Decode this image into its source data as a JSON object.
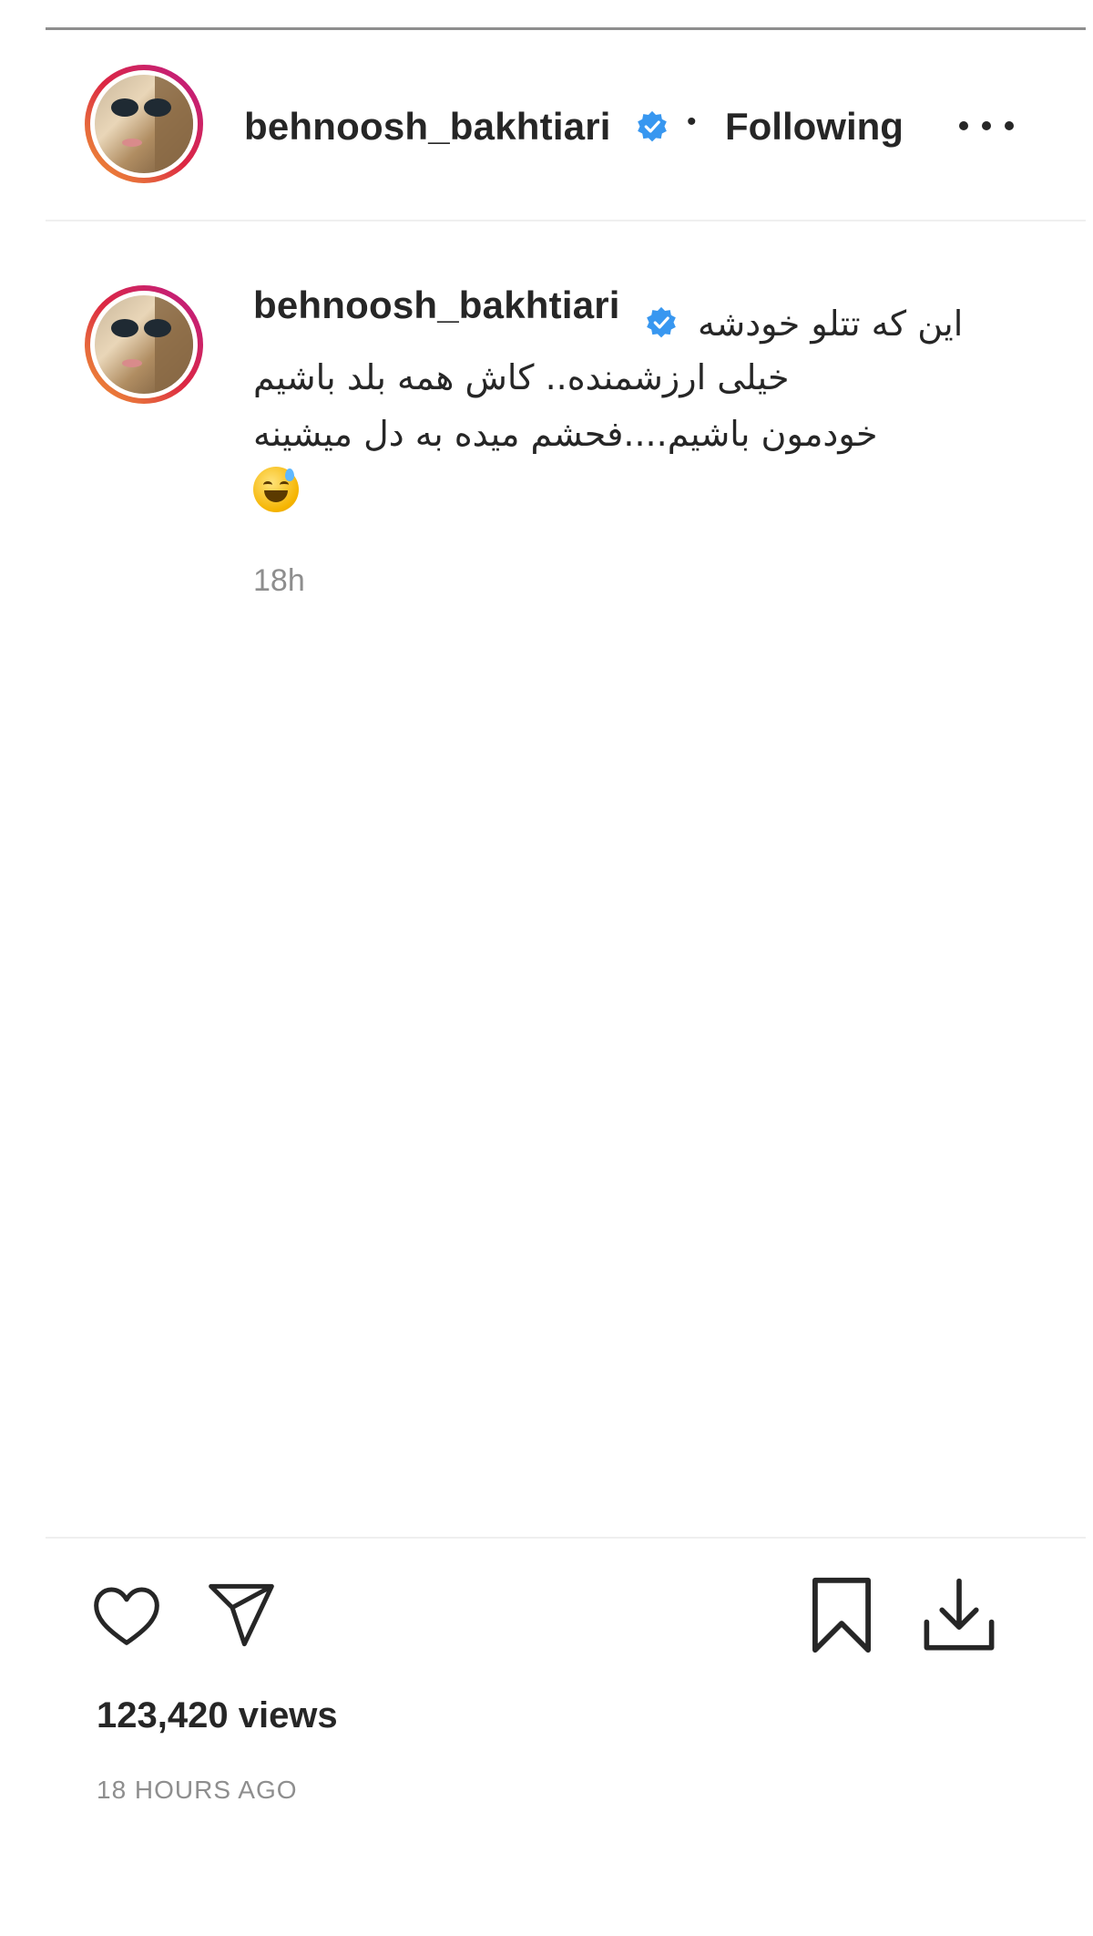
{
  "header": {
    "username": "behnoosh_bakhtiari",
    "separator": "•",
    "follow_status": "Following",
    "more_label": "..."
  },
  "caption": {
    "username": "behnoosh_bakhtiari",
    "lines": [
      "این که تتلو خودشه",
      "خیلی ارزشمنده.. کاش همه بلد باشیم",
      "خودمون باشیم....فحشم میده به دل میشینه"
    ],
    "emoji": "😅",
    "time": "18h"
  },
  "stats": {
    "views": "123,420 views",
    "posted": "18 HOURS AGO"
  },
  "icons": {
    "verified": "verified-badge-icon",
    "more": "more-options-icon",
    "like": "heart-icon",
    "share": "paper-plane-icon",
    "save": "bookmark-icon",
    "download": "download-icon"
  },
  "colors": {
    "verified_blue": "#3897f0",
    "text": "#262626",
    "muted": "#8e8e8e",
    "divider": "#efefef"
  }
}
